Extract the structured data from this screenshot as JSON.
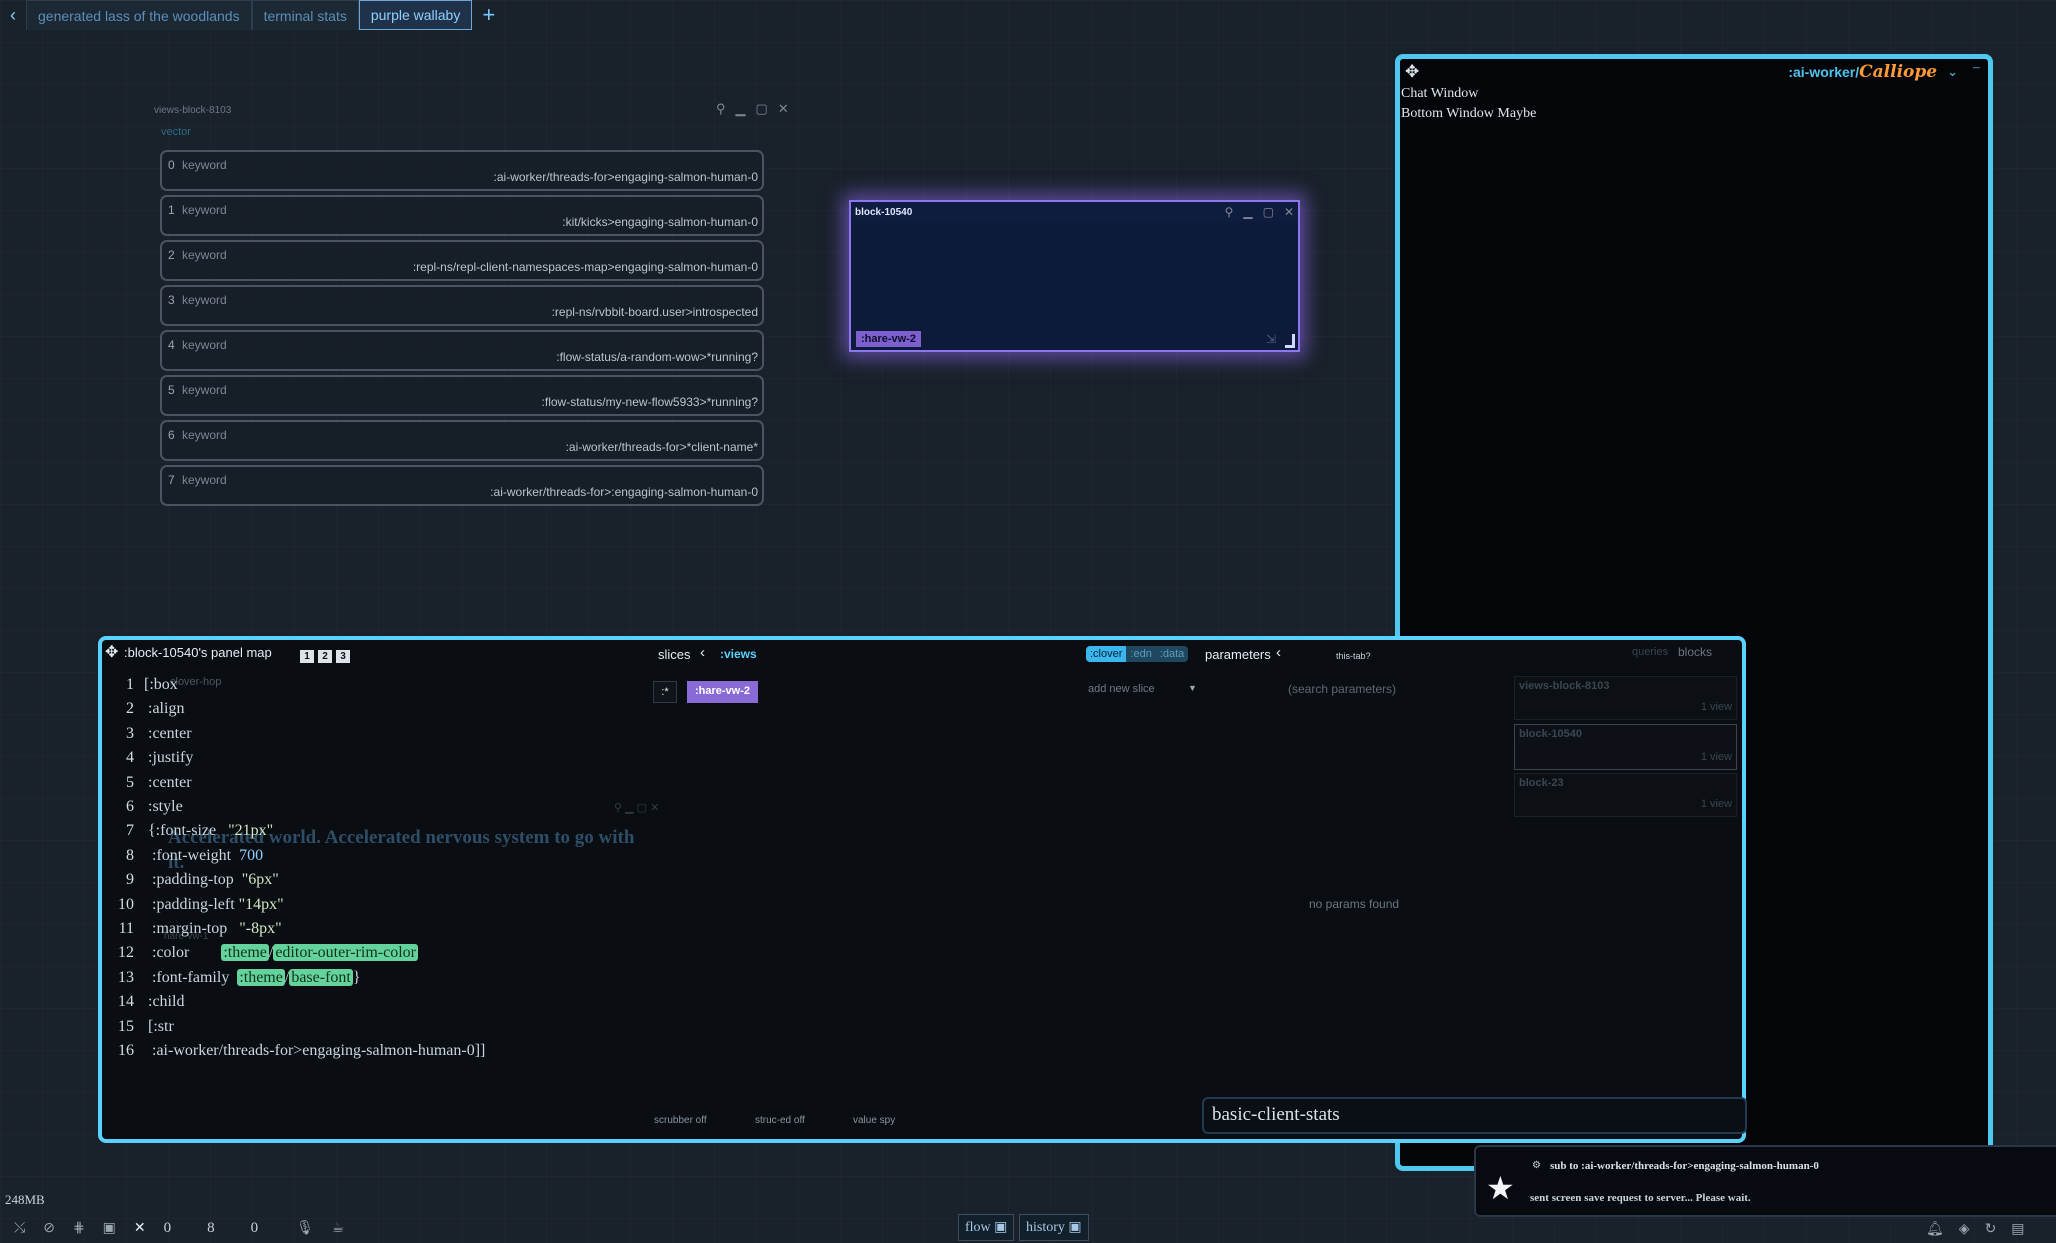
{
  "tabs": {
    "items": [
      {
        "label": "generated lass of the woodlands"
      },
      {
        "label": "terminal stats"
      },
      {
        "label": "purple wallaby"
      }
    ]
  },
  "views_block": {
    "title": "views-block-8103",
    "section": "vector",
    "rows": [
      {
        "idx": "0",
        "key": "keyword",
        "value": ":ai-worker/threads-for>engaging-salmon-human-0"
      },
      {
        "idx": "1",
        "key": "keyword",
        "value": ":kit/kicks>engaging-salmon-human-0"
      },
      {
        "idx": "2",
        "key": "keyword",
        "value": ":repl-ns/repl-client-namespaces-map>engaging-salmon-human-0"
      },
      {
        "idx": "3",
        "key": "keyword",
        "value": ":repl-ns/rvbbit-board.user>introspected"
      },
      {
        "idx": "4",
        "key": "keyword",
        "value": ":flow-status/a-random-wow>*running?"
      },
      {
        "idx": "5",
        "key": "keyword",
        "value": ":flow-status/my-new-flow5933>*running?"
      },
      {
        "idx": "6",
        "key": "keyword",
        "value": ":ai-worker/threads-for>*client-name*"
      },
      {
        "idx": "7",
        "key": "keyword",
        "value": ":ai-worker/threads-for>:engaging-salmon-human-0"
      }
    ]
  },
  "block_purple": {
    "title": "block-10540",
    "tag": ":hare-vw-2"
  },
  "calliope": {
    "title_prefix": ":ai-worker/",
    "title_name": "Calliope",
    "line1": "Chat Window",
    "line2": "Bottom Window Maybe"
  },
  "panel_map": {
    "title": ":block-10540's panel map",
    "nums": [
      "1",
      "2",
      "3"
    ],
    "slices_label": "slices",
    "views_label": ":views",
    "mode_clover": ":clover",
    "mode_edn": ":edn",
    "mode_data": ":data",
    "parameters_label": "parameters",
    "this_tab": "this-tab?",
    "queries": "queries",
    "blocks": "blocks",
    "ghost_clover": "clover-hop",
    "slice_star": ":*",
    "slice_tag": ":hare-vw-2",
    "add_slice": "add new slice",
    "search_params": "(search parameters)",
    "no_params": "no params found",
    "ghost_text": "Accelerated world. Accelerated nervous system to go with",
    "ghost_text2": "it.",
    "ghost_small": "hare-vw-1",
    "blocks_list": [
      {
        "name": "views-block-8103",
        "views": "1 view"
      },
      {
        "name": "block-10540",
        "views": "1 view"
      },
      {
        "name": "block-23",
        "views": "1 view"
      }
    ],
    "code_lines": [
      {
        "n": "1",
        "parts": [
          {
            "t": "[:box",
            "c": ""
          }
        ]
      },
      {
        "n": "2",
        "parts": [
          {
            "t": " :align",
            "c": ""
          }
        ]
      },
      {
        "n": "3",
        "parts": [
          {
            "t": " :center",
            "c": ""
          }
        ]
      },
      {
        "n": "4",
        "parts": [
          {
            "t": " :justify",
            "c": ""
          }
        ]
      },
      {
        "n": "5",
        "parts": [
          {
            "t": " :center",
            "c": ""
          }
        ]
      },
      {
        "n": "6",
        "parts": [
          {
            "t": " :style",
            "c": ""
          }
        ]
      },
      {
        "n": "7",
        "parts": [
          {
            "t": " {:font-size   ",
            "c": ""
          },
          {
            "t": "\"21px\"",
            "c": "str"
          }
        ]
      },
      {
        "n": "8",
        "parts": [
          {
            "t": "  :font-weight  ",
            "c": ""
          },
          {
            "t": "700",
            "c": "num"
          }
        ]
      },
      {
        "n": "9",
        "parts": [
          {
            "t": "  :padding-top  ",
            "c": ""
          },
          {
            "t": "\"6px\"",
            "c": "str"
          }
        ]
      },
      {
        "n": "10",
        "parts": [
          {
            "t": "  :padding-left ",
            "c": ""
          },
          {
            "t": "\"14px\"",
            "c": "str"
          }
        ]
      },
      {
        "n": "11",
        "parts": [
          {
            "t": "  :margin-top   ",
            "c": ""
          },
          {
            "t": "\"-8px\"",
            "c": "str"
          }
        ]
      },
      {
        "n": "12",
        "parts": [
          {
            "t": "  :color        ",
            "c": ""
          },
          {
            "t": ":theme",
            "c": "hl"
          },
          {
            "t": "/",
            "c": ""
          },
          {
            "t": "editor-outer-rim-color",
            "c": "hl"
          }
        ]
      },
      {
        "n": "13",
        "parts": [
          {
            "t": "  :font-family  ",
            "c": ""
          },
          {
            "t": ":theme",
            "c": "hl"
          },
          {
            "t": "/",
            "c": ""
          },
          {
            "t": "base-font",
            "c": "hl"
          },
          {
            "t": "}",
            "c": ""
          }
        ]
      },
      {
        "n": "14",
        "parts": [
          {
            "t": " :child",
            "c": ""
          }
        ]
      },
      {
        "n": "15",
        "parts": [
          {
            "t": " [:str",
            "c": ""
          }
        ]
      },
      {
        "n": "16",
        "parts": [
          {
            "t": "  :ai-worker/threads-for>engaging-salmon-human-0]]",
            "c": ""
          }
        ]
      }
    ],
    "scrubber": "scrubber off",
    "struc": "struc-ed off",
    "spy": "value spy"
  },
  "stats": {
    "label": "basic-client-stats"
  },
  "notification": {
    "line1": "sub to :ai-worker/threads-for>engaging-salmon-human-0",
    "line2": "sent screen save request to server... Please wait."
  },
  "bottom": {
    "memory": "248MB",
    "counters": [
      "0",
      "8",
      "0"
    ],
    "flow": "flow",
    "history": "history"
  },
  "colors": {
    "accent": "#5ad2ff",
    "purple": "#8d77f0",
    "code_highlight": "#63d39b"
  }
}
